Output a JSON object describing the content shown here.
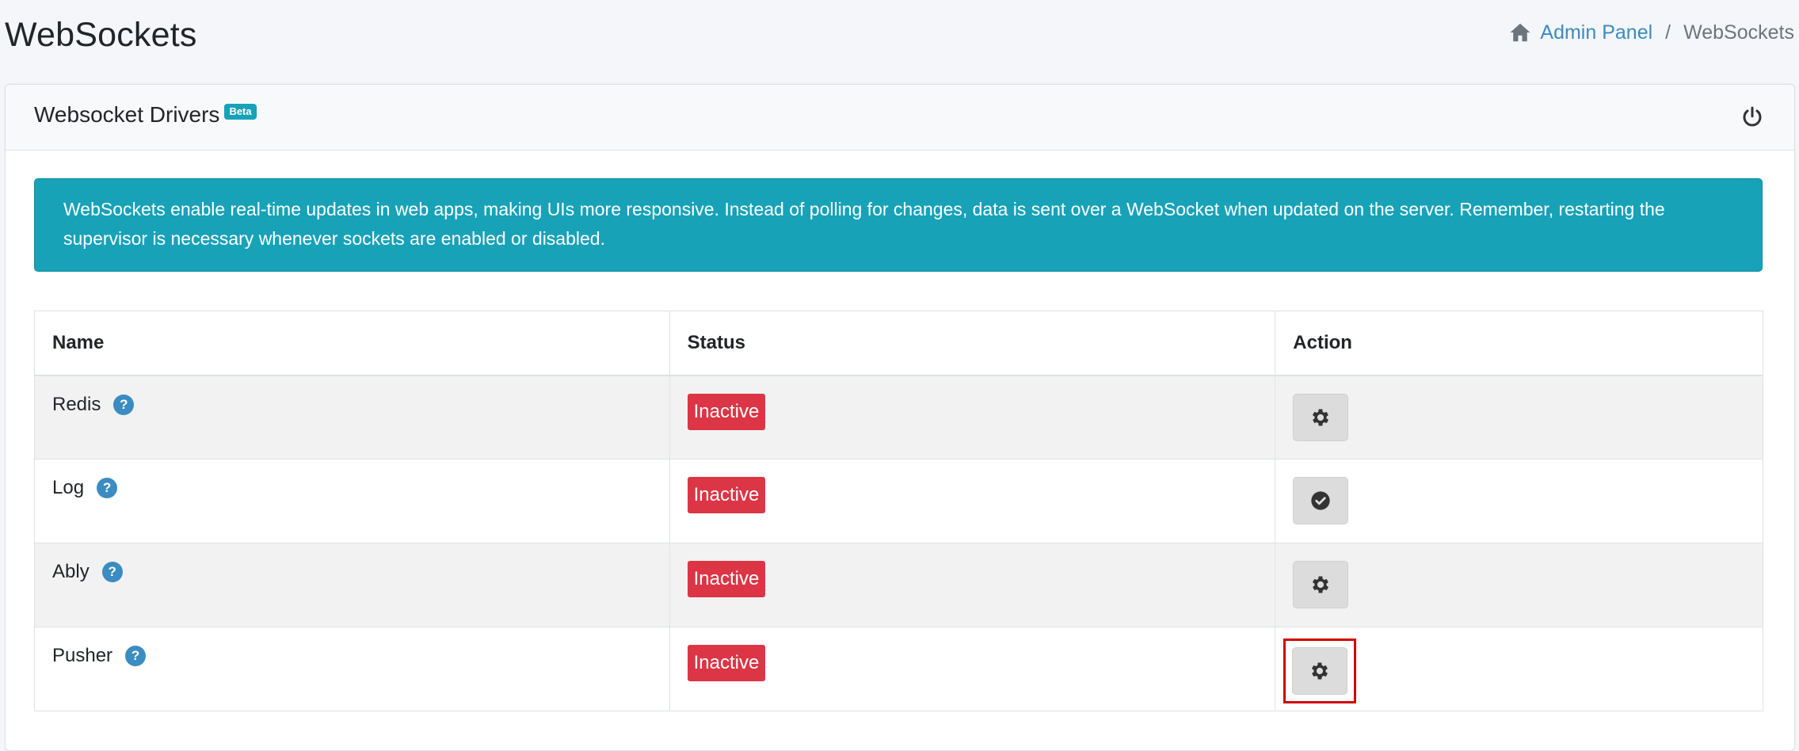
{
  "page": {
    "title": "WebSockets"
  },
  "breadcrumb": {
    "home_label": "Admin Panel",
    "separator": "/",
    "current": "WebSockets"
  },
  "card": {
    "title": "Websocket Drivers",
    "badge": "Beta",
    "power_icon": "power-icon"
  },
  "alert": {
    "text": "WebSockets enable real-time updates in web apps, making UIs more responsive. Instead of polling for changes, data is sent over a WebSocket when updated on the server. Remember, restarting the supervisor is necessary whenever sockets are enabled or disabled."
  },
  "table": {
    "headers": [
      "Name",
      "Status",
      "Action"
    ],
    "rows": [
      {
        "name": "Redis",
        "status": "Inactive",
        "action_icon": "gear-icon"
      },
      {
        "name": "Log",
        "status": "Inactive",
        "action_icon": "check-circle-icon"
      },
      {
        "name": "Ably",
        "status": "Inactive",
        "action_icon": "gear-icon"
      },
      {
        "name": "Pusher",
        "status": "Inactive",
        "action_icon": "gear-icon"
      }
    ]
  },
  "colors": {
    "info": "#17a2b8",
    "danger": "#dc3545",
    "link": "#3a8cc1",
    "highlight": "#d00000"
  }
}
